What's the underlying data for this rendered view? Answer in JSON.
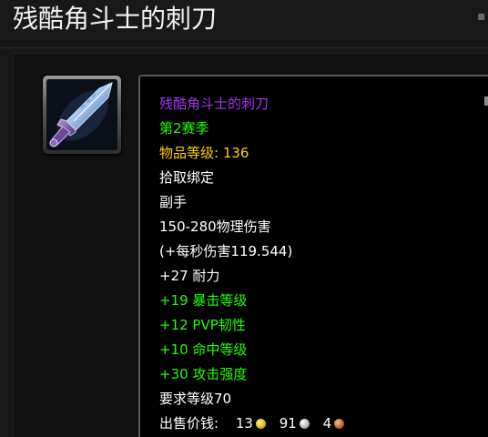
{
  "page": {
    "title": "残酷角斗士的刺刀"
  },
  "item": {
    "icon": "gladiator-blade-icon",
    "name": "残酷角斗士的刺刀",
    "season": "第2赛季",
    "item_level_label": "物品等级:",
    "item_level_value": "136",
    "binding": "拾取绑定",
    "slot": "副手",
    "damage": "150-280物理伤害",
    "dps": "(+每秒伤害119.544)",
    "stamina": "+27 耐力",
    "stats": [
      "+19 暴击等级",
      "+12 PVP韧性",
      "+10 命中等级",
      "+30 攻击强度"
    ],
    "required_level": "要求等级70",
    "sell_price": {
      "label": "出售价钱:",
      "gold": "13",
      "silver": "91",
      "copper": "4"
    }
  },
  "colors": {
    "epic": "#a335ee",
    "bonus_stat": "#1eff00",
    "item_level": "#ffd100",
    "text": "#ffffff",
    "background": "#181818",
    "tooltip_bg": "#000000"
  }
}
